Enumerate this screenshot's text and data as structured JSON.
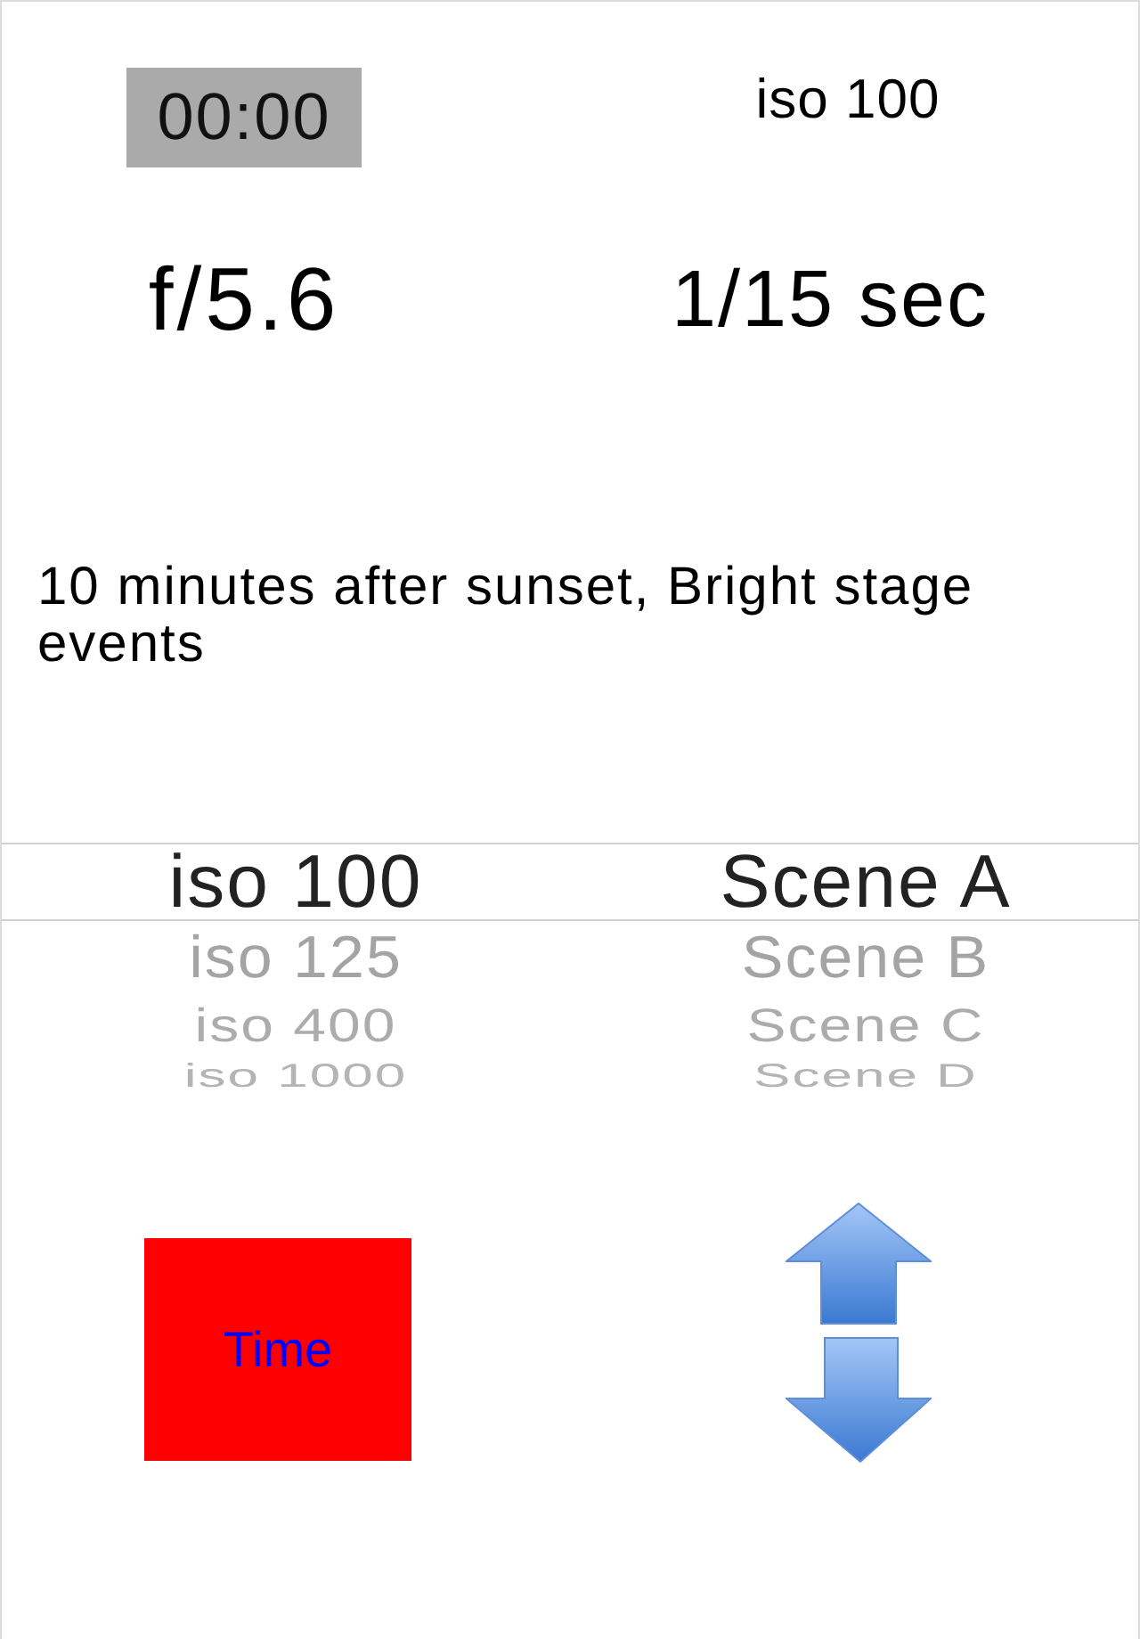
{
  "timer": {
    "label": "00:00"
  },
  "iso_reading": "iso 100",
  "aperture": "f/5.6",
  "shutter_speed": "1/15 sec",
  "description": "10 minutes after sunset, Bright stage events",
  "pickers": [
    {
      "items": [
        {
          "label": "iso 100",
          "selected": true
        },
        {
          "label": "iso 125",
          "selected": false
        },
        {
          "label": "iso 400",
          "selected": false
        },
        {
          "label": "iso 1000",
          "selected": false
        }
      ]
    },
    {
      "items": [
        {
          "label": "Scene A",
          "selected": true
        },
        {
          "label": "Scene B",
          "selected": false
        },
        {
          "label": "Scene C",
          "selected": false
        },
        {
          "label": "Scene D",
          "selected": false
        }
      ]
    }
  ],
  "time_button": {
    "label": "Time"
  }
}
